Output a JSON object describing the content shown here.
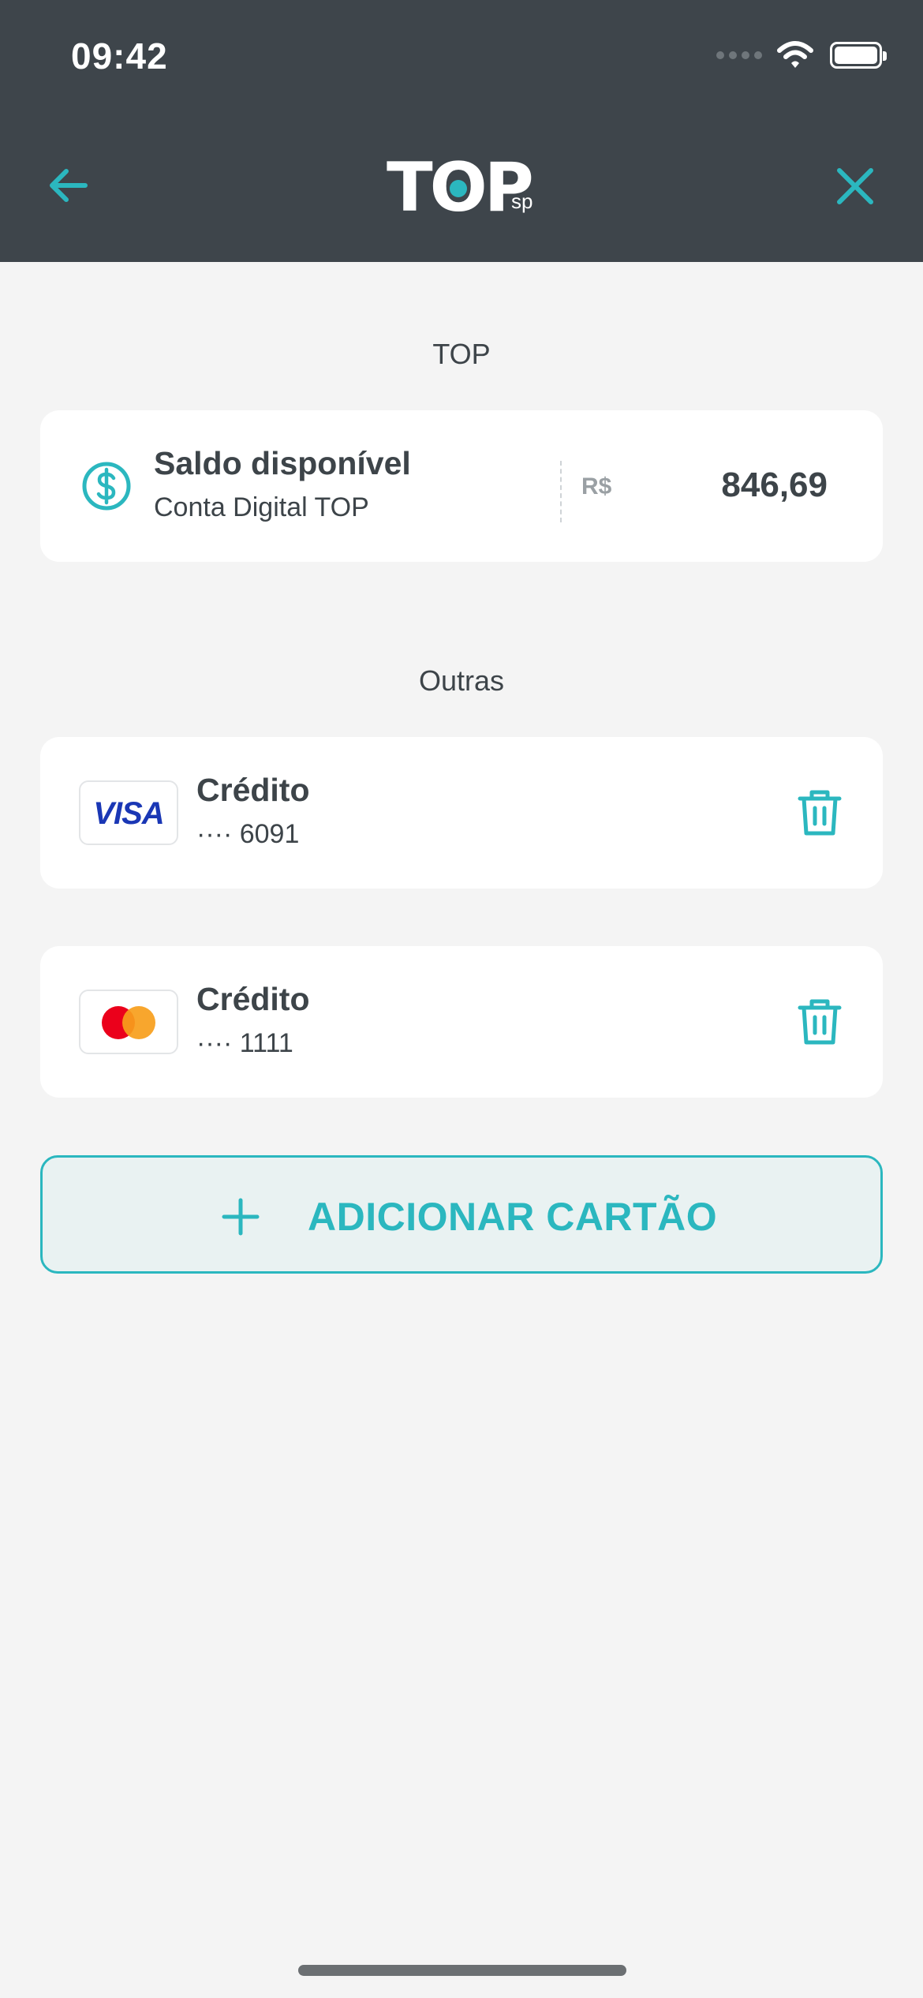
{
  "status_bar": {
    "time": "09:42"
  },
  "header": {
    "logo_text": "TOP",
    "logo_suffix": "sp",
    "back_icon": "arrow-left-icon",
    "close_icon": "close-icon"
  },
  "colors": {
    "accent": "#2bb7bf",
    "header_bg": "#3e454b",
    "background": "#f4f4f4",
    "text": "#3d4449"
  },
  "top_section": {
    "title": "TOP",
    "balance_card": {
      "icon": "dollar-circle-icon",
      "title": "Saldo disponível",
      "subtitle": "Conta Digital TOP",
      "currency": "R$",
      "amount": "846,69"
    }
  },
  "others_section": {
    "title": "Outras",
    "cards": [
      {
        "brand": "VISA",
        "type": "Crédito",
        "number": "···· 6091",
        "delete_icon": "trash-icon"
      },
      {
        "brand": "mastercard",
        "type": "Crédito",
        "number": "···· 1111",
        "delete_icon": "trash-icon"
      }
    ]
  },
  "add_button": {
    "label": "ADICIONAR CARTÃO",
    "icon": "plus-icon"
  }
}
